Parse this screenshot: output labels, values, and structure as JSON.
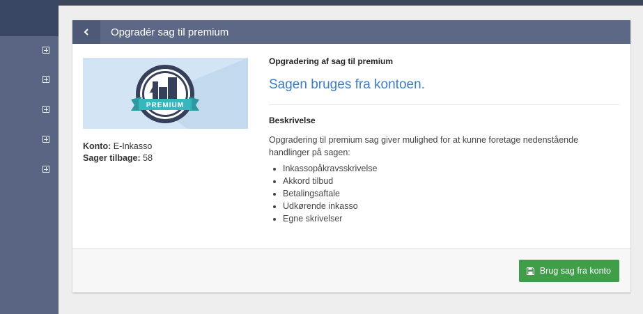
{
  "sidebar": {
    "items": [
      {
        "icon": "plus-square-icon"
      },
      {
        "icon": "plus-square-icon"
      },
      {
        "icon": "plus-square-icon"
      },
      {
        "icon": "plus-square-icon"
      },
      {
        "icon": "plus-square-icon"
      }
    ]
  },
  "header": {
    "back_icon": "chevron-left-icon",
    "title": "Opgradér sag til premium"
  },
  "badge": {
    "text": "PREMIUM"
  },
  "account": {
    "konto_label": "Konto:",
    "konto_value": "E-Inkasso",
    "sager_label": "Sager tilbage:",
    "sager_value": "58"
  },
  "main": {
    "upgrade_title": "Opgradering af sag til premium",
    "status": "Sagen bruges fra kontoen.",
    "description_heading": "Beskrivelse",
    "description_text": "Opgradering til premium sag giver mulighed for at kunne foretage nedenstående handlinger på sagen:",
    "features": [
      "Inkassopåkravsskrivelse",
      "Akkord tilbud",
      "Betalingsaftale",
      "Udkørende inkasso",
      "Egne skrivelser"
    ]
  },
  "footer": {
    "button_icon": "floppy-disk-icon",
    "button_label": "Brug sag fra konto"
  },
  "colors": {
    "sidebar": "#5a6483",
    "header": "#5d6786",
    "accent": "#3a7dd0",
    "button": "#3f9e48"
  }
}
